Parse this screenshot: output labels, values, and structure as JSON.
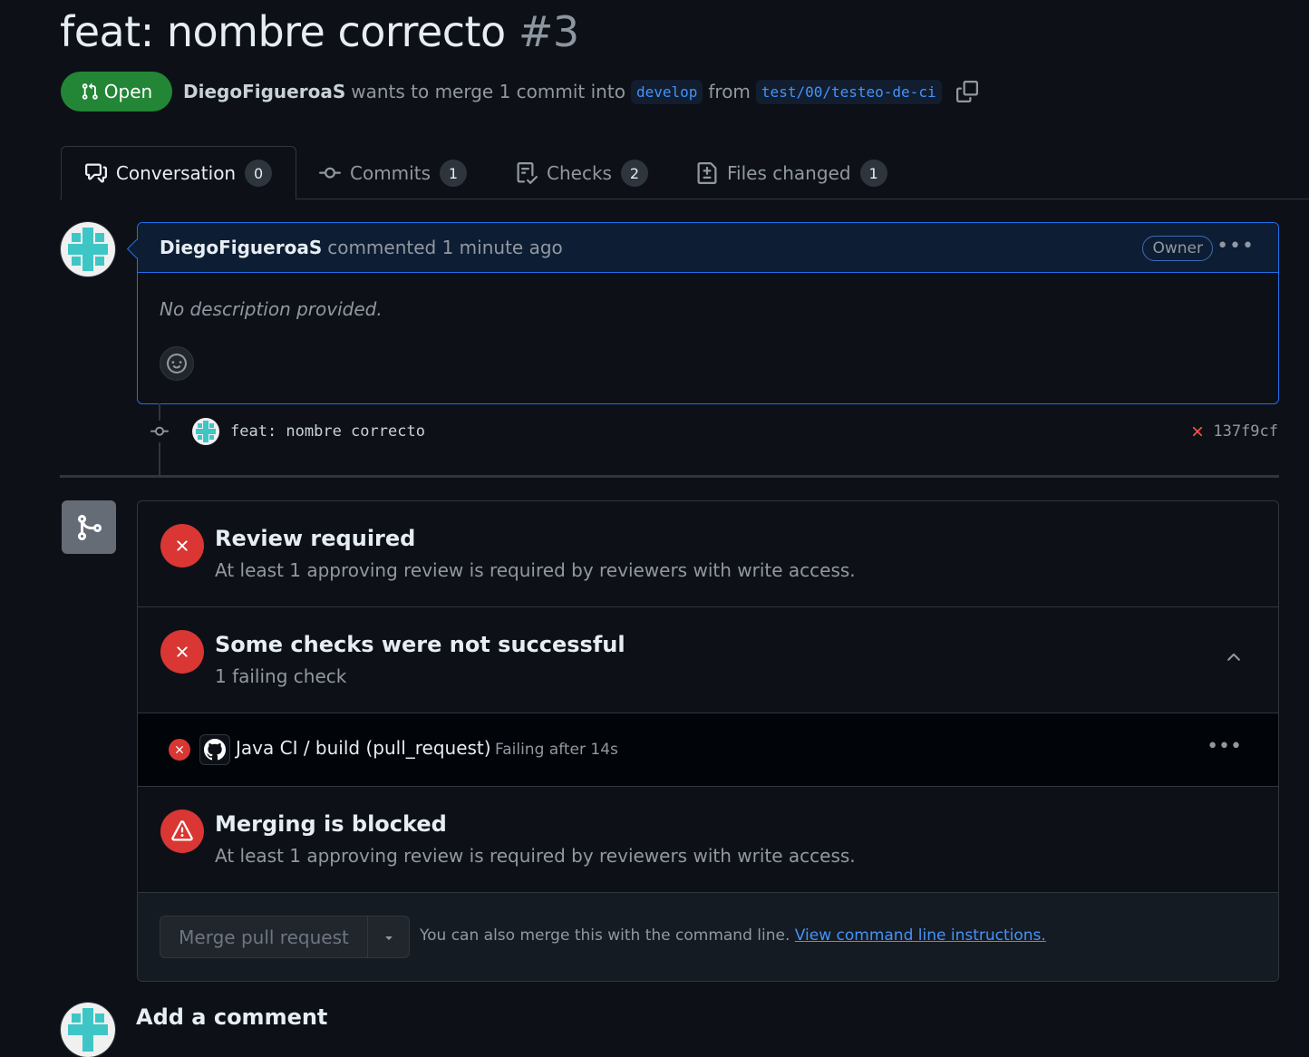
{
  "pr": {
    "title": "feat: nombre correcto",
    "number": "#3",
    "state": "Open",
    "author": "DiegoFigueroaS",
    "merge_text": "wants to merge 1 commit into",
    "base_branch": "develop",
    "from_text": "from",
    "head_branch": "test/00/testeo-de-ci"
  },
  "tabs": [
    {
      "label": "Conversation",
      "count": "0"
    },
    {
      "label": "Commits",
      "count": "1"
    },
    {
      "label": "Checks",
      "count": "2"
    },
    {
      "label": "Files changed",
      "count": "1"
    }
  ],
  "comment": {
    "author": "DiegoFigueroaS",
    "meta": "commented 1 minute ago",
    "badge": "Owner",
    "body": "No description provided."
  },
  "commit": {
    "message": "feat: nombre correcto",
    "sha": "137f9cf"
  },
  "merge_box": {
    "review": {
      "title": "Review required",
      "subtitle": "At least 1 approving review is required by reviewers with write access."
    },
    "checks": {
      "title": "Some checks were not successful",
      "subtitle": "1 failing check"
    },
    "check_item": {
      "name": "Java CI / build (pull_request)",
      "status": "Failing after 14s"
    },
    "blocked": {
      "title": "Merging is blocked",
      "subtitle": "At least 1 approving review is required by reviewers with write access."
    },
    "merge_button": "Merge pull request",
    "hint_text": "You can also merge this with the command line.",
    "hint_link": "View command line instructions."
  },
  "add_comment": "Add a comment",
  "colors": {
    "background": "#0d1117",
    "open_green": "#238636",
    "danger_red": "#da3633",
    "accent_blue": "#1f6feb",
    "link_blue": "#4493f8"
  }
}
